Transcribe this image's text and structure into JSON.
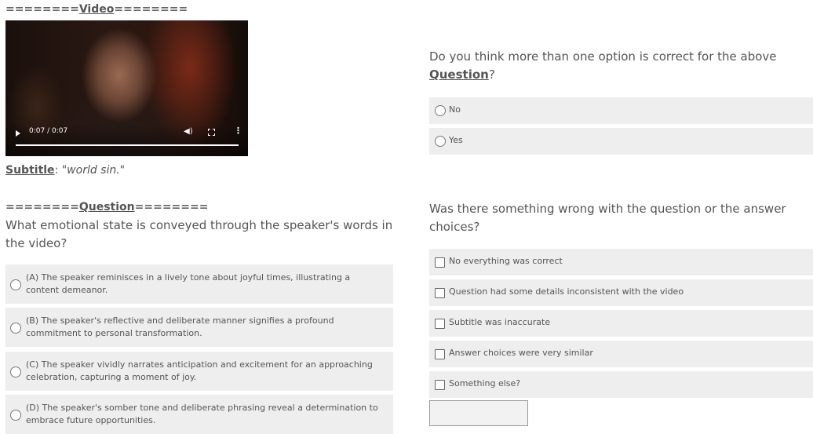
{
  "video_header": {
    "left": "========",
    "label": "Video",
    "right": "========"
  },
  "video": {
    "time": "0:07 / 0:07",
    "progress": 1.0
  },
  "subtitle": {
    "label": "Subtitle",
    "sep": ": ",
    "text": "\"world sin.\""
  },
  "question_header": {
    "left": "========",
    "label": "Question",
    "right": "========"
  },
  "question": {
    "text": "What emotional state is conveyed through the speaker's words in the video?"
  },
  "options": [
    {
      "text": "(A) The speaker reminisces in a lively tone about joyful times, illustrating a content demeanor."
    },
    {
      "text": "(B) The speaker's reflective and deliberate manner signifies a profound commitment to personal transformation."
    },
    {
      "text": "(C) The speaker vividly narrates anticipation and excitement for an approaching celebration, capturing a moment of joy."
    },
    {
      "text": "(D) The speaker's somber tone and deliberate phrasing reveal a determination to embrace future opportunities."
    }
  ],
  "multi_question": {
    "prefix": "Do you think more than one option is correct for the above",
    "link": "Question",
    "suffix": "?"
  },
  "multi_options": [
    "No",
    "Yes"
  ],
  "wrong_question": {
    "text": "Was there something wrong with the question or the answer choices?"
  },
  "wrong_options": [
    "No everything was correct",
    "Question had some details inconsistent with the video",
    "Subtitle was inaccurate",
    "Answer choices were very similar",
    "Something else?"
  ],
  "other_input": {
    "value": ""
  }
}
